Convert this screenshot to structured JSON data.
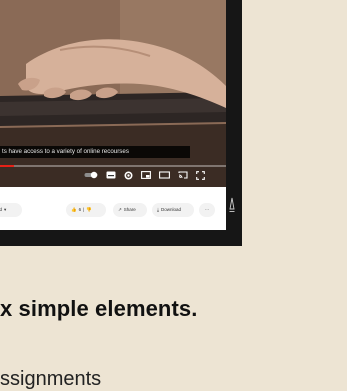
{
  "video": {
    "caption": "ts have access to  a variety of online recourses",
    "progress_fraction": 0.06,
    "icons": [
      "autoplay-toggle-icon",
      "subtitles-icon",
      "settings-icon",
      "miniplayer-icon",
      "theater-mode-icon",
      "cast-icon",
      "fullscreen-icon"
    ]
  },
  "actions": {
    "left_chip_label": "ed",
    "like_count": "6",
    "share_label": "Share",
    "download_label": "Download",
    "more_label": "···"
  },
  "page": {
    "heading": "x simple elements.",
    "partial_line": "ssignments"
  },
  "colors": {
    "background": "#ede4d3",
    "frame": "#161616",
    "progress": "#e62117"
  }
}
